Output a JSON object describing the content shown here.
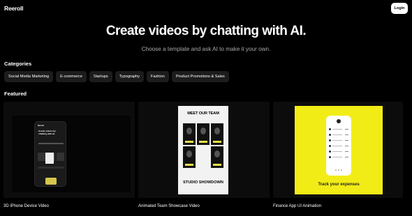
{
  "header": {
    "logo": "Reeroll",
    "login_label": "Login"
  },
  "hero": {
    "title": "Create videos by chatting with AI.",
    "subtitle": "Choose a template and ask AI to make it your own."
  },
  "categories": {
    "heading": "Categories",
    "items": [
      "Social Media Marketing",
      "E-commerce",
      "Startups",
      "Typography",
      "Fashion",
      "Product Promotions & Sales"
    ]
  },
  "featured": {
    "heading": "Featured",
    "cards": [
      {
        "caption": "3D iPhone Device Video",
        "preview": {
          "app_logo": "Reeroll",
          "app_title": "Create videos by chatting with AI."
        }
      },
      {
        "caption": "Animated Team Showcase Video",
        "preview": {
          "top_text": "MEET OUR TEAM",
          "bottom_text": "STUDIO SHOWDOWN"
        }
      },
      {
        "caption": "Finance App UI Animation",
        "preview": {
          "text": "Track your expenses"
        }
      }
    ]
  },
  "colors": {
    "background": "#000000",
    "chip_bg": "#1c1c1c",
    "accent_yellow": "#f2ec16"
  }
}
